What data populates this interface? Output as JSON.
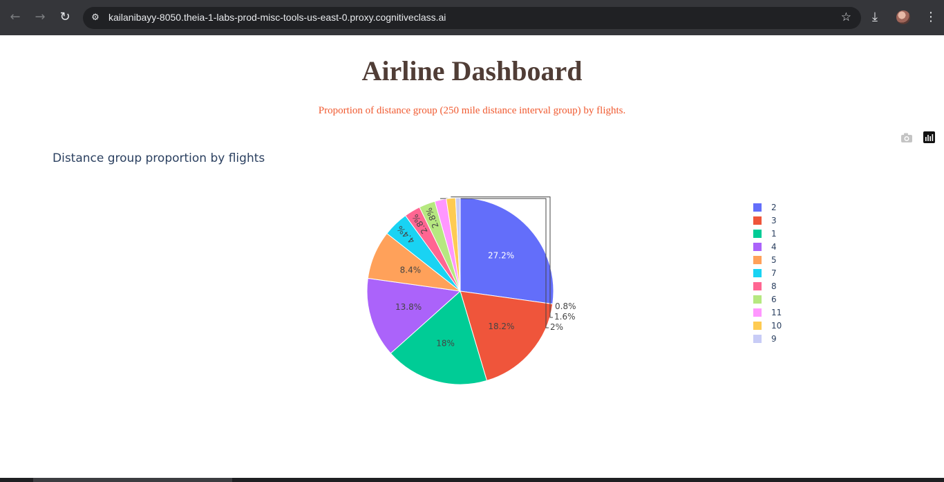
{
  "browser": {
    "url": "kailanibayy-8050.theia-1-labs-prod-misc-tools-us-east-0.proxy.cognitiveclass.ai",
    "icons": [
      "back-icon",
      "forward-icon",
      "reload-icon",
      "site-info-icon",
      "bookmark-star-icon",
      "download-icon",
      "avatar",
      "more-menu-icon"
    ]
  },
  "page": {
    "title": "Airline Dashboard",
    "subtitle": "Proportion of distance group (250 mile distance interval group) by flights.",
    "title_color": "#503D36",
    "subtitle_color": "#F05A30"
  },
  "modebar": {
    "icons": [
      "camera-icon",
      "plotly-logo-icon"
    ]
  },
  "chart_data": {
    "type": "pie",
    "title": "Distance group proportion by flights",
    "legend_position": "right",
    "labels": [
      "2",
      "3",
      "1",
      "4",
      "5",
      "7",
      "8",
      "6",
      "11",
      "10",
      "9"
    ],
    "values": [
      27.2,
      18.2,
      18.0,
      13.8,
      8.4,
      4.4,
      2.8,
      2.8,
      2.0,
      1.6,
      0.8
    ],
    "text_labels": [
      "27.2%",
      "18.2%",
      "18%",
      "13.8%",
      "8.4%",
      "4.4%",
      "2.8%",
      "2.8%",
      "2%",
      "1.6%",
      "0.8%"
    ],
    "colors": [
      "#636EFA",
      "#EF553B",
      "#00CC96",
      "#AB63FA",
      "#FFA15A",
      "#19D3F3",
      "#FF6692",
      "#B6E880",
      "#FF97FF",
      "#FECB52",
      "#C8CCF6"
    ]
  }
}
